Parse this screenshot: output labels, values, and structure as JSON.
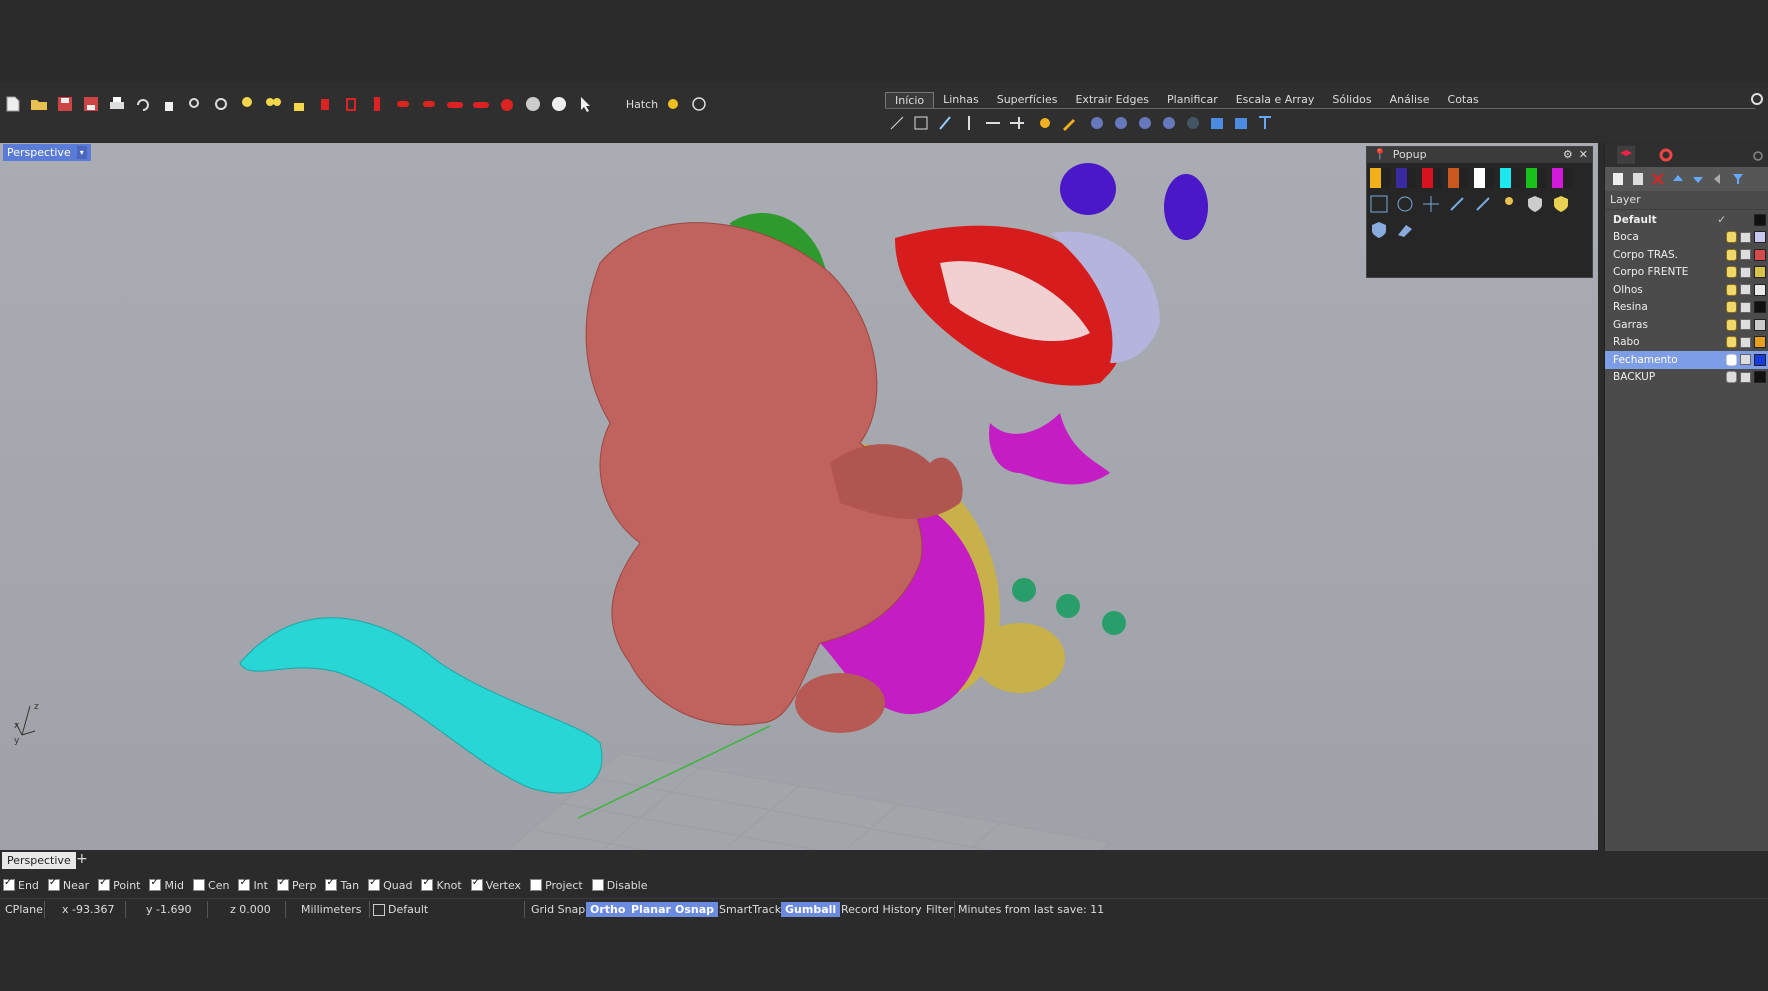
{
  "toolbar": {
    "hatch_label": "Hatch",
    "tabs": [
      "Início",
      "Linhas",
      "Superfícies",
      "Extrair Edges",
      "Planificar",
      "Escala e Array",
      "Sólidos",
      "Análise",
      "Cotas"
    ]
  },
  "viewport": {
    "label": "Perspective",
    "axis_labels": {
      "x": "x",
      "y": "y",
      "z": "z"
    }
  },
  "popup": {
    "title": "Popup",
    "swatch_colors": [
      "#f2b01a",
      "#3a2aa0",
      "#d8121e",
      "#c9581e",
      "#ffffff",
      "#1ee8ef",
      "#18c21a",
      "#d31ad8"
    ]
  },
  "layers": {
    "header": "Layer",
    "rows": [
      {
        "name": "Default",
        "color": "#111111",
        "bold": true,
        "current": true
      },
      {
        "name": "Boca",
        "color": "#c9c9f0"
      },
      {
        "name": "Corpo TRAS.",
        "color": "#d84a4a"
      },
      {
        "name": "Corpo FRENTE",
        "color": "#d8c44a"
      },
      {
        "name": "Olhos",
        "color": "#e8e8e8"
      },
      {
        "name": "Resina",
        "color": "#111111"
      },
      {
        "name": "Garras",
        "color": "#cccccc"
      },
      {
        "name": "Rabo",
        "color": "#e8a020"
      },
      {
        "name": "Fechamento",
        "color": "#1a3ae0",
        "selected": true
      },
      {
        "name": "BACKUP",
        "color": "#111111"
      }
    ]
  },
  "viewport_tabs": {
    "active": "Perspective",
    "add": "+"
  },
  "osnaps": [
    {
      "label": "End",
      "checked": true
    },
    {
      "label": "Near",
      "checked": true
    },
    {
      "label": "Point",
      "checked": true
    },
    {
      "label": "Mid",
      "checked": true
    },
    {
      "label": "Cen",
      "checked": false
    },
    {
      "label": "Int",
      "checked": true
    },
    {
      "label": "Perp",
      "checked": true
    },
    {
      "label": "Tan",
      "checked": true
    },
    {
      "label": "Quad",
      "checked": true
    },
    {
      "label": "Knot",
      "checked": true
    },
    {
      "label": "Vertex",
      "checked": true
    },
    {
      "label": "Project",
      "checked": false
    },
    {
      "label": "Disable",
      "checked": false
    }
  ],
  "status": {
    "cplane": "CPlane",
    "x": "x -93.367",
    "y": "y -1.690",
    "z": "z 0.000",
    "units": "Millimeters",
    "layer": "Default",
    "grid_snap": "Grid Snap",
    "ortho": "Ortho",
    "planar": "Planar",
    "osnap": "Osnap",
    "smarttrack": "SmartTrack",
    "gumball": "Gumball",
    "record_history": "Record History",
    "filter": "Filter",
    "last_save": "Minutes from last save: 11"
  }
}
